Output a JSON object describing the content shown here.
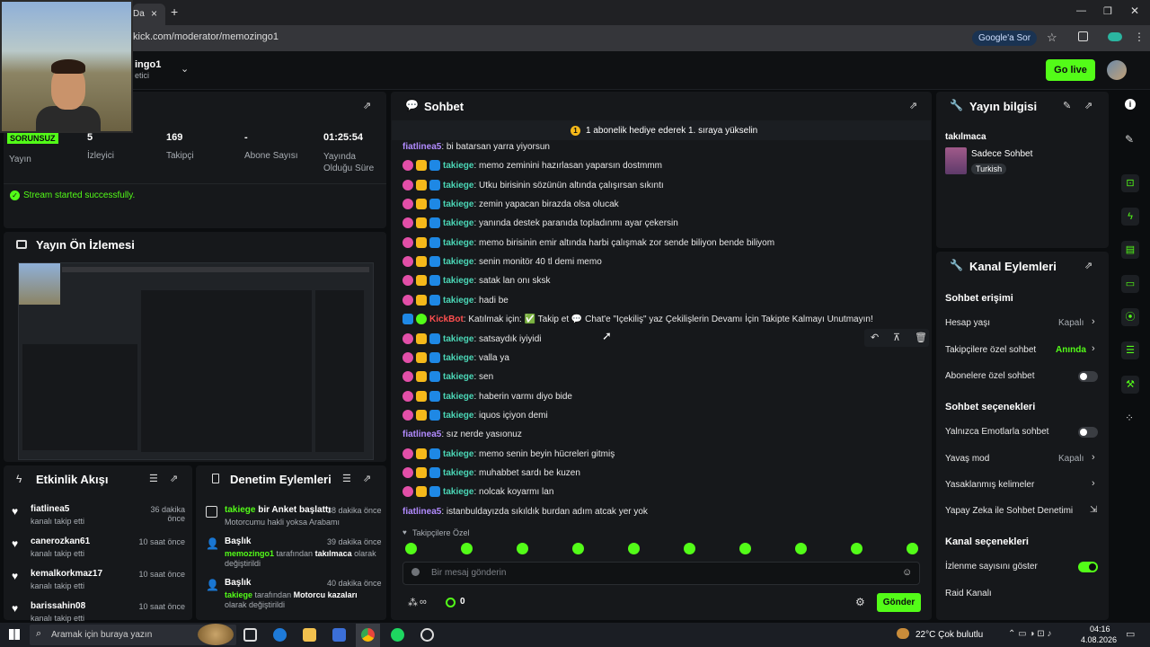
{
  "browser": {
    "tab_close": "×",
    "tab_new": "+",
    "url": "kick.com/moderator/memozingo1",
    "google_ask": "Google'a Sor",
    "tab_fragment": "Da"
  },
  "header": {
    "channel_name": "ingo1",
    "channel_role": "etici",
    "go_live": "Go live"
  },
  "stats": {
    "status_badge": "SORUNSUZ",
    "items": [
      {
        "value": "",
        "label": "Yayın"
      },
      {
        "value": "5",
        "label": "İzleyici"
      },
      {
        "value": "169",
        "label": "Takipçi"
      },
      {
        "value": "-",
        "label": "Abone Sayısı"
      },
      {
        "value": "01:25:54",
        "label": "Yayında Olduğu Süre"
      }
    ],
    "stream_message": "Stream started successfully."
  },
  "preview": {
    "title": "Yayın Ön İzlemesi"
  },
  "activity": {
    "title": "Etkinlik Akışı",
    "items": [
      {
        "name": "fiatlinea5",
        "sub": "kanalı takip etti",
        "time": "36 dakika önce"
      },
      {
        "name": "canerozkan61",
        "sub": "kanalı takip etti",
        "time": "10 saat önce"
      },
      {
        "name": "kemalkorkmaz17",
        "sub": "kanalı takip etti",
        "time": "10 saat önce"
      },
      {
        "name": "barissahin08",
        "sub": "kanalı takip etti",
        "time": "10 saat önce"
      }
    ]
  },
  "moderation": {
    "title": "Denetim Eylemleri",
    "items": [
      {
        "head_user": "takiege",
        "head_text": "bir Anket başlattı",
        "time": "38 dakika önce",
        "detail": "Motorcumu hakli yoksa Arabamı"
      },
      {
        "head_text": "Başlık",
        "time": "39 dakika önce",
        "detail_user": "memozingo1",
        "detail_mid": "tarafından",
        "detail_val": "takılmaca",
        "detail_end": "olarak değiştirildi"
      },
      {
        "head_text": "Başlık",
        "time": "40 dakika önce",
        "detail_user": "takiege",
        "detail_mid": "tarafından",
        "detail_val": "Motorcu kazaları",
        "detail_end": "olarak değiştirildi"
      }
    ]
  },
  "chat": {
    "title": "Sohbet",
    "pinned": "1 abonelik hediye ederek 1. sıraya yükselin",
    "messages": [
      {
        "user": "fiatlinea5",
        "color": "fiat",
        "badges": [],
        "text": ": bi batarsan yarra yiyorsun"
      },
      {
        "user": "takiege",
        "color": "takiege",
        "badges": [
          "sub",
          "crown",
          "mod"
        ],
        "text": ": memo zeminini hazırlasan yaparsın dostmmm"
      },
      {
        "user": "takiege",
        "color": "takiege",
        "badges": [
          "sub",
          "crown",
          "mod"
        ],
        "text": ": Utku birisinin sözünün altında çalışırsan sıkıntı"
      },
      {
        "user": "takiege",
        "color": "takiege",
        "badges": [
          "sub",
          "crown",
          "mod"
        ],
        "text": ": zemin yapacan birazda olsa olucak"
      },
      {
        "user": "takiege",
        "color": "takiege",
        "badges": [
          "sub",
          "crown",
          "mod"
        ],
        "text": ": yanında destek paranıda topladınmı ayar çekersin"
      },
      {
        "user": "takiege",
        "color": "takiege",
        "badges": [
          "sub",
          "crown",
          "mod"
        ],
        "text": ": memo birisinin emir altında harbi çalışmak zor sende biliyon bende biliyom"
      },
      {
        "user": "takiege",
        "color": "takiege",
        "badges": [
          "sub",
          "crown",
          "mod"
        ],
        "text": ": senin monitör 40 tl demi memo"
      },
      {
        "user": "takiege",
        "color": "takiege",
        "badges": [
          "sub",
          "crown",
          "mod"
        ],
        "text": ": satak lan onı sksk"
      },
      {
        "user": "takiege",
        "color": "takiege",
        "badges": [
          "sub",
          "crown",
          "mod"
        ],
        "text": ": hadi be"
      },
      {
        "user": "KickBot",
        "color": "bot",
        "badges": [
          "mod",
          "vip"
        ],
        "text": ": Katılmak için: ✅ Takip et 💬 Chat'e \"Içekiliş\" yaz Çekilişlerin Devamı İçin Takipte Kalmayı Unutmayın!"
      },
      {
        "user": "takiege",
        "color": "takiege",
        "badges": [
          "sub",
          "crown",
          "mod"
        ],
        "text": ": satsaydık iyiyidi"
      },
      {
        "user": "takiege",
        "color": "takiege",
        "badges": [
          "sub",
          "crown",
          "mod"
        ],
        "text": ": valla ya"
      },
      {
        "user": "takiege",
        "color": "takiege",
        "badges": [
          "sub",
          "crown",
          "mod"
        ],
        "text": ": sen"
      },
      {
        "user": "takiege",
        "color": "takiege",
        "badges": [
          "sub",
          "crown",
          "mod"
        ],
        "text": ": haberin varmı diyo bide"
      },
      {
        "user": "takiege",
        "color": "takiege",
        "badges": [
          "sub",
          "crown",
          "mod"
        ],
        "text": ": iquos içiyon demi"
      },
      {
        "user": "fiatlinea5",
        "color": "fiat",
        "badges": [],
        "text": ": sız nerde yasıonuz"
      },
      {
        "user": "takiege",
        "color": "takiege",
        "badges": [
          "sub",
          "crown",
          "mod"
        ],
        "text": ": memo senin beyin hücreleri gitmiş"
      },
      {
        "user": "takiege",
        "color": "takiege",
        "badges": [
          "sub",
          "crown",
          "mod"
        ],
        "text": ": muhabbet sardı be kuzen"
      },
      {
        "user": "takiege",
        "color": "takiege",
        "badges": [
          "sub",
          "crown",
          "mod"
        ],
        "text": ": nolcak koyarmı lan"
      },
      {
        "user": "fiatlinea5",
        "color": "fiat",
        "badges": [],
        "text": ": istanbuldayızda sıkıldık burdan adım atcak yer yok"
      }
    ],
    "followers_only_label": "Takipçilere Özel",
    "input_placeholder": "Bir mesaj gönderin",
    "points": "0",
    "send": "Gönder"
  },
  "stream_info": {
    "title": "Yayın bilgisi",
    "stream_title": "takılmaca",
    "category": "Sadece Sohbet",
    "language": "Turkish"
  },
  "channel_actions": {
    "title": "Kanal Eylemleri",
    "chat_access_heading": "Sohbet erişimi",
    "account_age": {
      "label": "Hesap yaşı",
      "value": "Kapalı"
    },
    "followers_only": {
      "label": "Takipçilere özel sohbet",
      "value": "Anında"
    },
    "subscribers_only": {
      "label": "Abonelere özel sohbet"
    },
    "chat_options_heading": "Sohbet seçenekleri",
    "emotes_only": {
      "label": "Yalnızca Emotlarla sohbet"
    },
    "slow_mode": {
      "label": "Yavaş mod",
      "value": "Kapalı"
    },
    "banned_words": {
      "label": "Yasaklanmış kelimeler"
    },
    "ai_moderation": {
      "label": "Yapay Zeka ile Sohbet Denetimi"
    },
    "channel_options_heading": "Kanal seçenekleri",
    "show_viewers": {
      "label": "İzlenme sayısını göster"
    },
    "raid": {
      "label": "Raid Kanalı"
    }
  },
  "taskbar": {
    "search_placeholder": "Aramak için buraya yazın",
    "weather": "22°C  Çok bulutlu",
    "time": "04:16",
    "date": "4.08.2026"
  },
  "colors": {
    "accent": "#53fc18",
    "panel": "#16181b",
    "background": "#0b0d0f"
  }
}
